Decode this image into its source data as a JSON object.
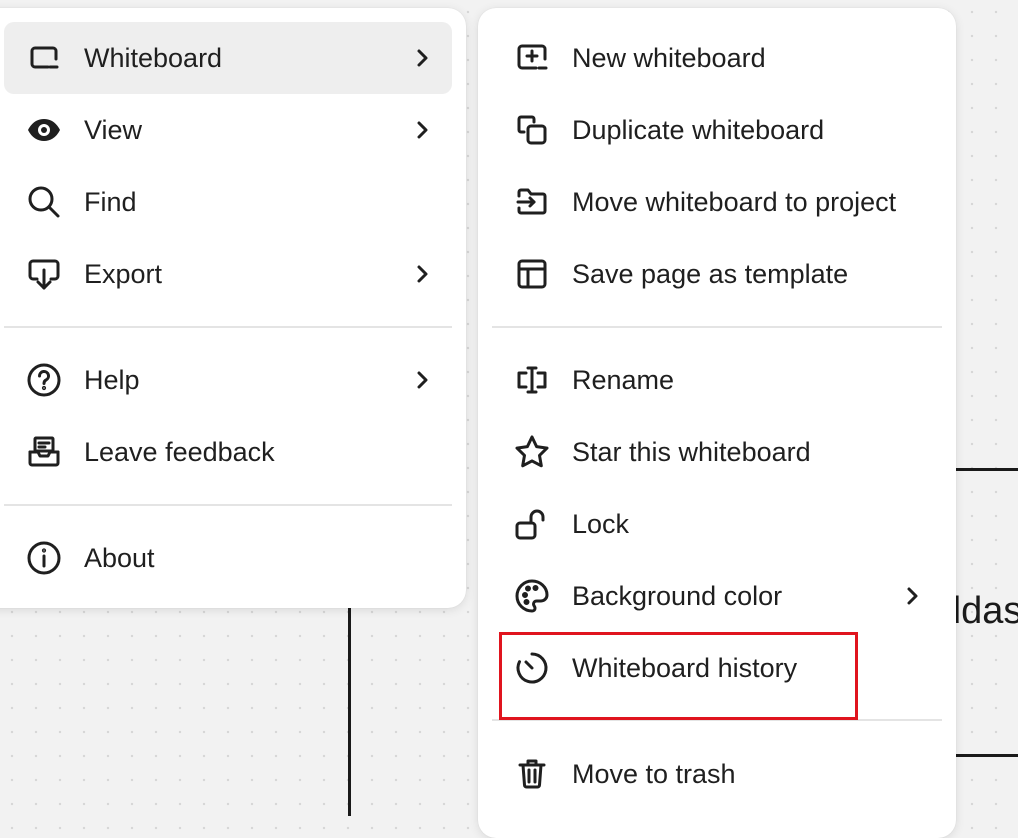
{
  "canvas": {
    "partial_text": "ddas"
  },
  "main_menu": {
    "items": [
      {
        "label": "Whiteboard",
        "icon": "whiteboard-icon",
        "submenu": true,
        "active": true
      },
      {
        "label": "View",
        "icon": "eye-icon",
        "submenu": true
      },
      {
        "label": "Find",
        "icon": "search-icon",
        "submenu": false
      },
      {
        "label": "Export",
        "icon": "export-icon",
        "submenu": true
      },
      {
        "label": "Help",
        "icon": "help-circle-icon",
        "submenu": true
      },
      {
        "label": "Leave feedback",
        "icon": "feedback-inbox-icon",
        "submenu": false
      },
      {
        "label": "About",
        "icon": "info-icon",
        "submenu": false
      }
    ]
  },
  "sub_menu": {
    "items": [
      {
        "label": "New whiteboard",
        "icon": "new-whiteboard-icon"
      },
      {
        "label": "Duplicate whiteboard",
        "icon": "duplicate-icon"
      },
      {
        "label": "Move whiteboard to project",
        "icon": "move-to-folder-icon"
      },
      {
        "label": "Save page as template",
        "icon": "template-icon"
      },
      {
        "label": "Rename",
        "icon": "rename-icon"
      },
      {
        "label": "Star this whiteboard",
        "icon": "star-icon"
      },
      {
        "label": "Lock",
        "icon": "unlock-icon"
      },
      {
        "label": "Background color",
        "icon": "palette-icon",
        "submenu": true
      },
      {
        "label": "Whiteboard history",
        "icon": "history-icon",
        "highlighted": true
      },
      {
        "label": "Move to trash",
        "icon": "trash-icon"
      }
    ]
  },
  "colors": {
    "highlight_border": "#e0141e",
    "active_item_bg": "#eeeeee",
    "menu_bg": "#ffffff"
  }
}
